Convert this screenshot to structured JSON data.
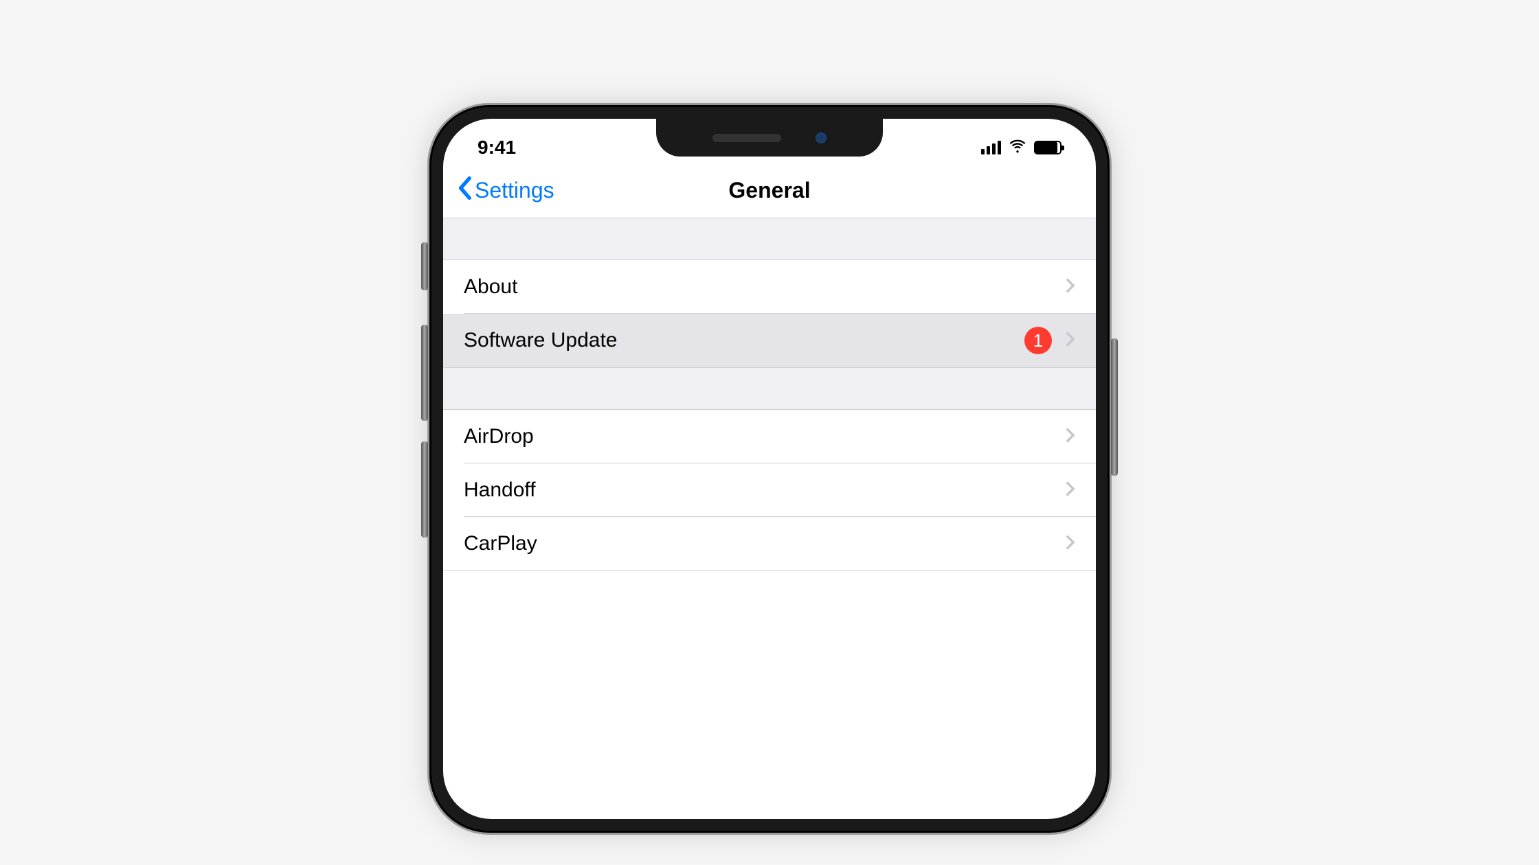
{
  "status_bar": {
    "time": "9:41"
  },
  "nav": {
    "back_label": "Settings",
    "title": "General"
  },
  "groups": [
    {
      "items": [
        {
          "label": "About",
          "badge": null,
          "highlighted": false
        },
        {
          "label": "Software Update",
          "badge": "1",
          "highlighted": true
        }
      ]
    },
    {
      "items": [
        {
          "label": "AirDrop",
          "badge": null,
          "highlighted": false
        },
        {
          "label": "Handoff",
          "badge": null,
          "highlighted": false
        },
        {
          "label": "CarPlay",
          "badge": null,
          "highlighted": false
        }
      ]
    }
  ],
  "colors": {
    "accent": "#007aff",
    "badge": "#ff3b30",
    "separator": "#d1d1d4",
    "grouped_bg": "#efeff4"
  }
}
